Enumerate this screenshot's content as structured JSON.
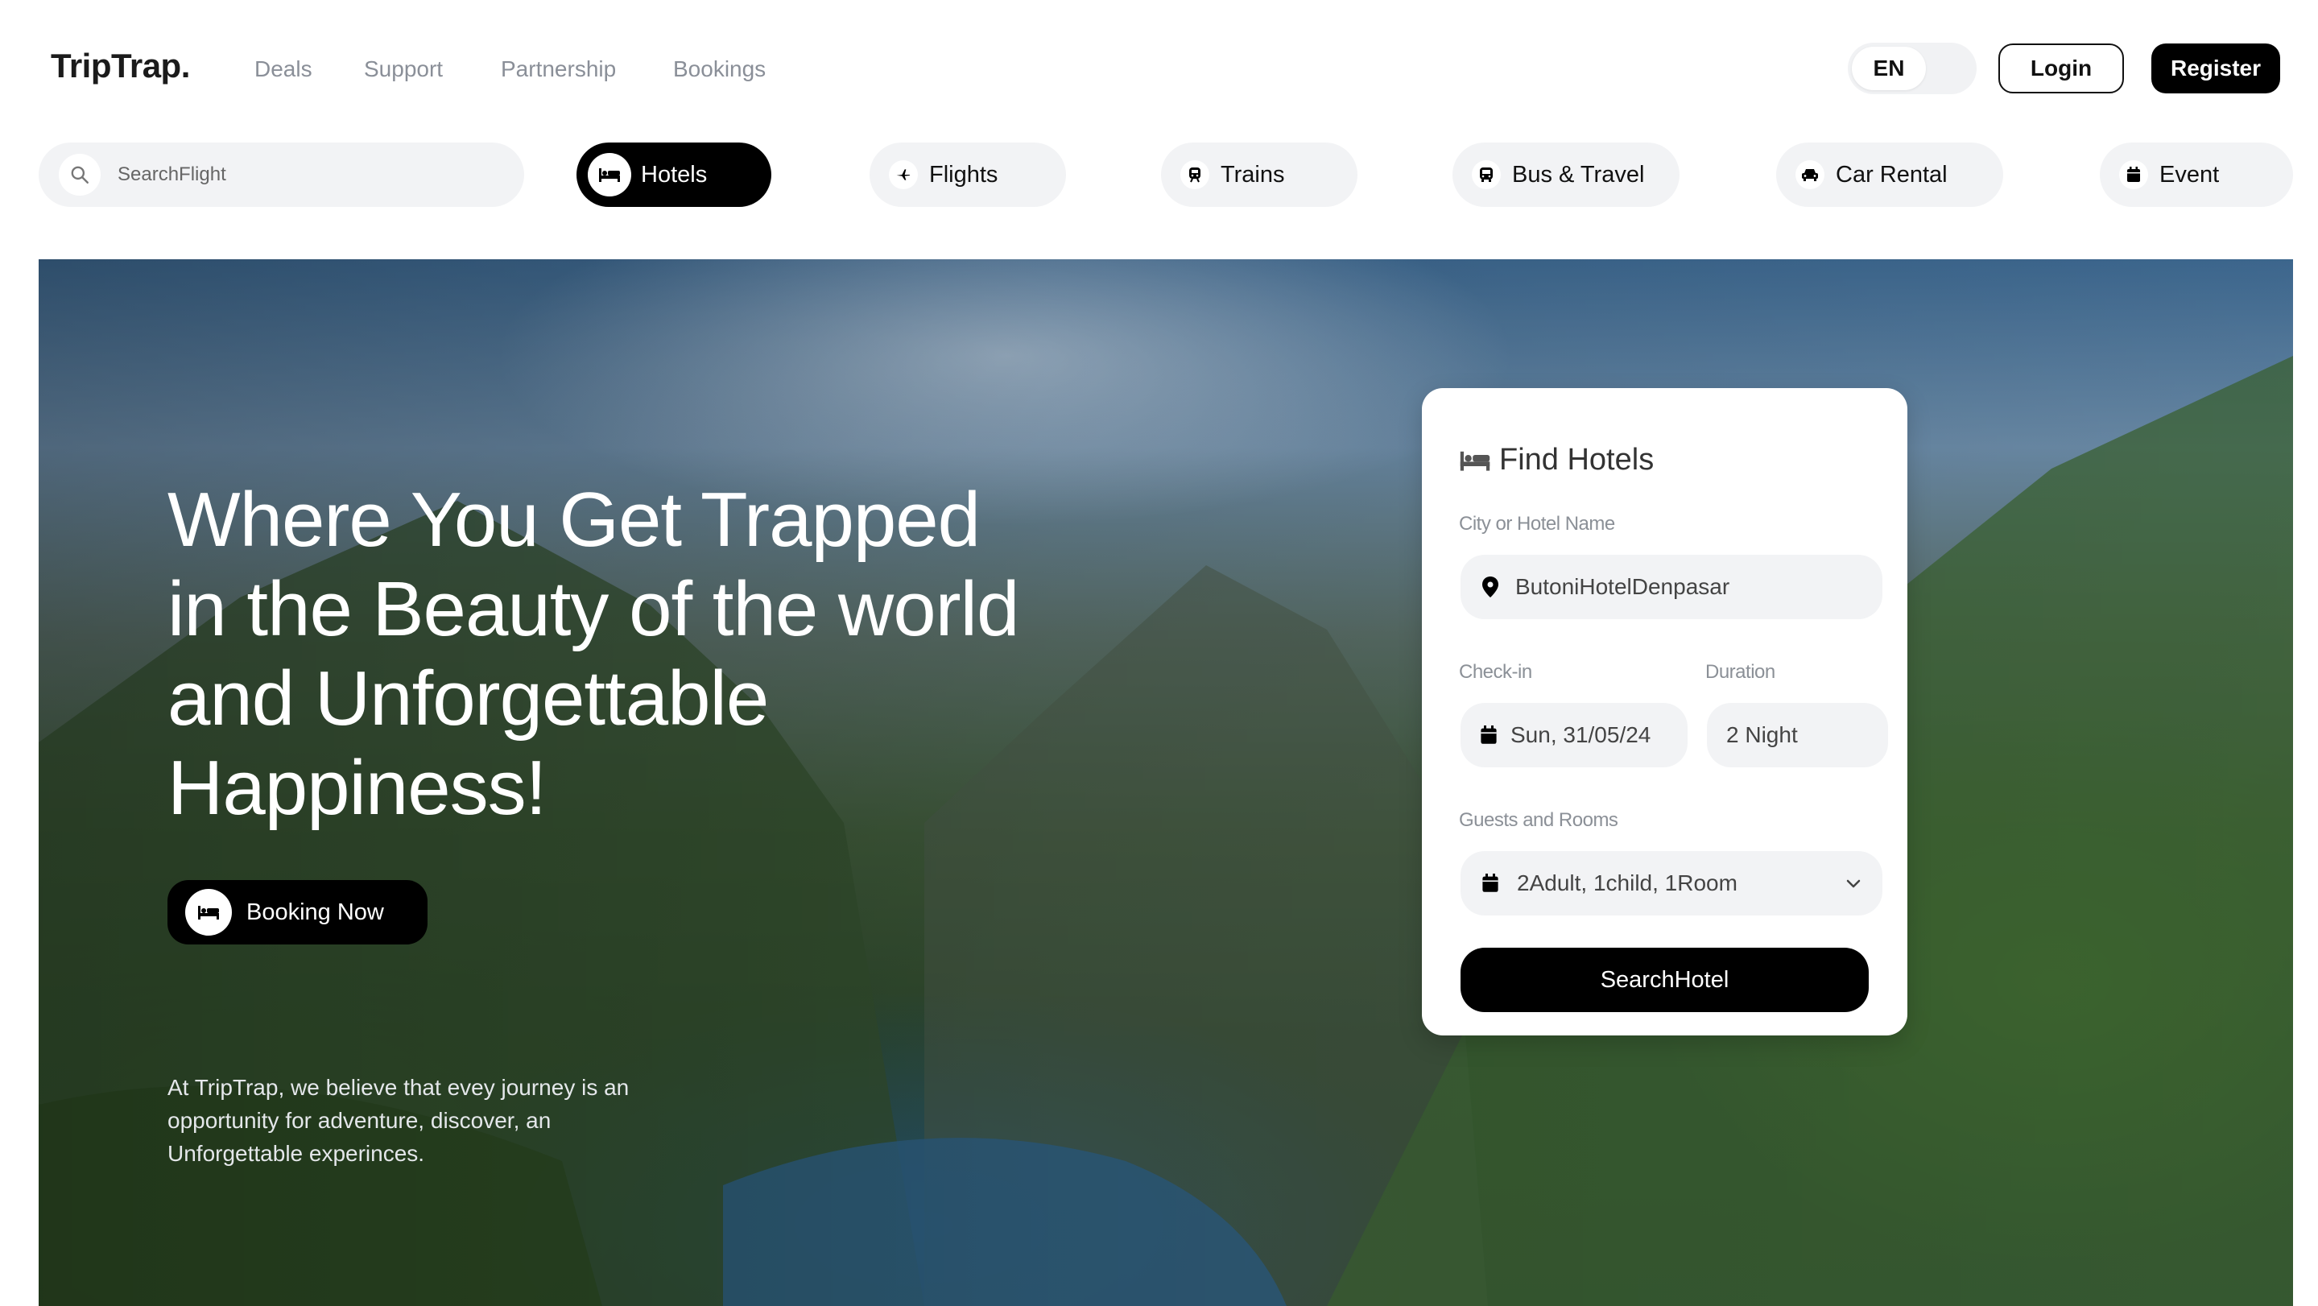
{
  "header": {
    "logo": "TripTrap.",
    "nav": [
      "Deals",
      "Support",
      "Partnership",
      "Bookings"
    ],
    "language": "EN",
    "login_label": "Login",
    "register_label": "Register"
  },
  "search": {
    "placeholder": "SearchFlight"
  },
  "tabs": [
    {
      "label": "Hotels",
      "icon": "bed-icon",
      "active": true
    },
    {
      "label": "Flights",
      "icon": "plane-icon",
      "active": false
    },
    {
      "label": "Trains",
      "icon": "train-icon",
      "active": false
    },
    {
      "label": "Bus & Travel",
      "icon": "bus-icon",
      "active": false
    },
    {
      "label": "Car Rental",
      "icon": "car-icon",
      "active": false
    },
    {
      "label": "Event",
      "icon": "calendar-icon",
      "active": false
    }
  ],
  "hero": {
    "title_lines": [
      "Where You Get Trapped",
      "in the Beauty of the world",
      "and Unforgettable",
      "Happiness!"
    ],
    "booking_label": "Booking Now",
    "description_lines": [
      "At TripTrap, we believe that evey journey is an",
      "opportunity for adventure, discover, an",
      "Unforgettable experinces."
    ]
  },
  "find_hotels": {
    "title": "Find Hotels",
    "city_label": "City or Hotel Name",
    "city_value": "ButoniHotelDenpasar",
    "checkin_label": "Check-in",
    "checkin_value": "Sun, 31/05/24",
    "duration_label": "Duration",
    "duration_value": "2 Night",
    "guests_label": "Guests and Rooms",
    "guests_value": "2Adult, 1child, 1Room",
    "search_label": "SearchHotel"
  },
  "colors": {
    "primary": "#000000",
    "tab_bg": "#f2f3f5",
    "nav_text": "#8a8f98"
  }
}
